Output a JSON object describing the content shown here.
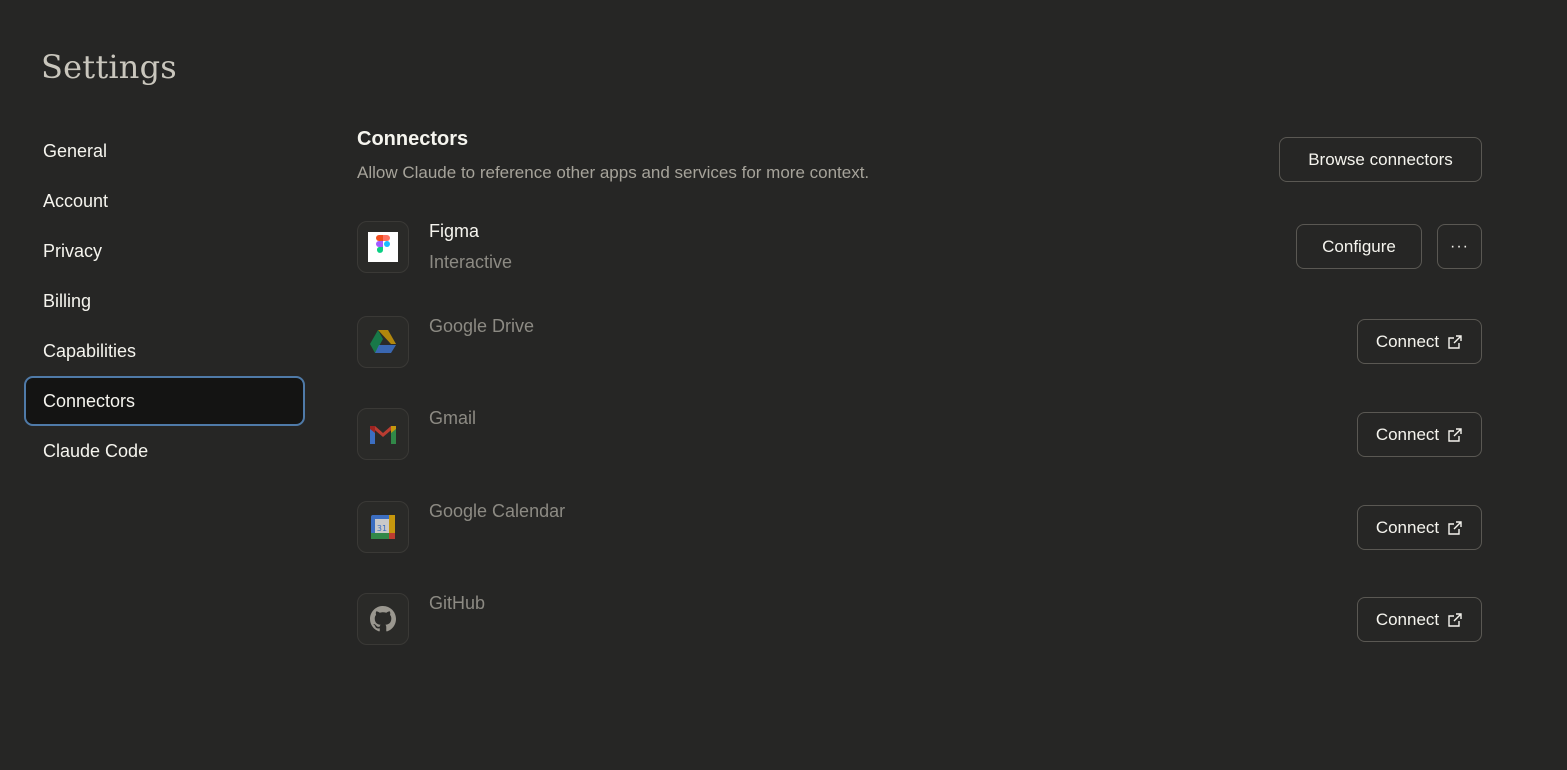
{
  "title": "Settings",
  "sidebar": {
    "items": [
      {
        "label": "General"
      },
      {
        "label": "Account"
      },
      {
        "label": "Privacy"
      },
      {
        "label": "Billing"
      },
      {
        "label": "Capabilities"
      },
      {
        "label": "Connectors",
        "active": true
      },
      {
        "label": "Claude Code"
      }
    ]
  },
  "connectors": {
    "title": "Connectors",
    "description": "Allow Claude to reference other apps and services for more context.",
    "browse_label": "Browse connectors",
    "items": [
      {
        "name": "Figma",
        "status": "Interactive",
        "icon": "figma-icon",
        "action": "Configure",
        "more": "···"
      },
      {
        "name": "Google Drive",
        "icon": "google-drive-icon",
        "action": "Connect"
      },
      {
        "name": "Gmail",
        "icon": "gmail-icon",
        "action": "Connect"
      },
      {
        "name": "Google Calendar",
        "icon": "google-calendar-icon",
        "icon_text": "31",
        "action": "Connect"
      },
      {
        "name": "GitHub",
        "icon": "github-icon",
        "action": "Connect"
      }
    ]
  },
  "colors": {
    "background": "#262625",
    "active_nav_bg": "#141413",
    "active_nav_border": "#4f7aa8",
    "text_primary": "#f5f4ee",
    "text_muted": "#8c8a83"
  }
}
